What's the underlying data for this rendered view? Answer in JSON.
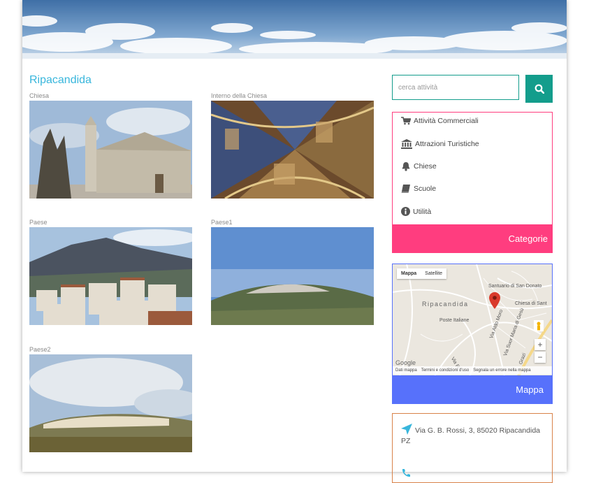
{
  "content": {
    "title": "Ripacandida",
    "photos": [
      {
        "caption": "Chiesa"
      },
      {
        "caption": "Interno della Chiesa"
      },
      {
        "caption": "Paese"
      },
      {
        "caption": "Paese1"
      },
      {
        "caption": "Paese2"
      }
    ]
  },
  "sidebar": {
    "search": {
      "placeholder": "cerca attività",
      "icon": "search-icon"
    },
    "categories": {
      "items": [
        {
          "label": "Attività Commerciali",
          "icon": "cart-icon"
        },
        {
          "label": "Attrazioni Turistiche",
          "icon": "bank-icon"
        },
        {
          "label": "Chiese",
          "icon": "bell-icon"
        },
        {
          "label": "Scuole",
          "icon": "book-icon"
        },
        {
          "label": "Utilità",
          "icon": "info-icon"
        }
      ],
      "footer": "Categorie",
      "color": "#ff3d7f"
    },
    "map": {
      "tabs": [
        "Mappa",
        "Satellite"
      ],
      "labels": [
        "Ripacandida",
        "Santuario di San Donato",
        "Chiesa di Sant",
        "Poste Italiane",
        "Via Aldo Moro",
        "Via Suor Maria di Gesù",
        "Via Pi",
        "Grazi"
      ],
      "zoom_in": "+",
      "zoom_out": "−",
      "bottom": [
        "Dati mappa",
        "Termini e condizioni d'uso",
        "Segnala un errore nella mappa"
      ],
      "brand": "Google",
      "footer": "Mappa",
      "color": "#5771fb"
    },
    "address": {
      "text": "Via G. B. Rossi, 3, 85020 Ripacandida PZ",
      "icon": "location-arrow-icon",
      "color": "#d9824a"
    }
  },
  "colors": {
    "accent": "#38b6dc",
    "search": "#139d8c"
  }
}
